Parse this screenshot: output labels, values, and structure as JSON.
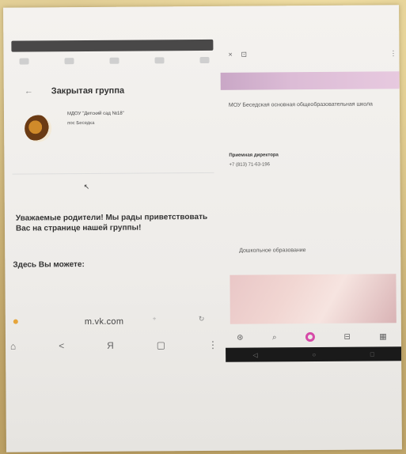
{
  "left_phone": {
    "title": "Закрытая группа",
    "group_name": "МДОУ \"Детский сад №18\"",
    "group_location": "пос Беседка",
    "welcome_message": "Уважаемые родители! Мы рады приветствовать Вас на странице нашей группы!",
    "here_you_can": "Здесь Вы можете:",
    "url": "m.vk.com"
  },
  "right_phone": {
    "school_name": "МОУ Беседская основная общеобразовательная школа",
    "director_label": "Приемная директора",
    "phone": "+7 (813) 71-63-196",
    "section_title": "Дошкольное образование"
  },
  "colors": {
    "accent_ring": "#d64aa8",
    "banner": "#dcbcd6"
  }
}
